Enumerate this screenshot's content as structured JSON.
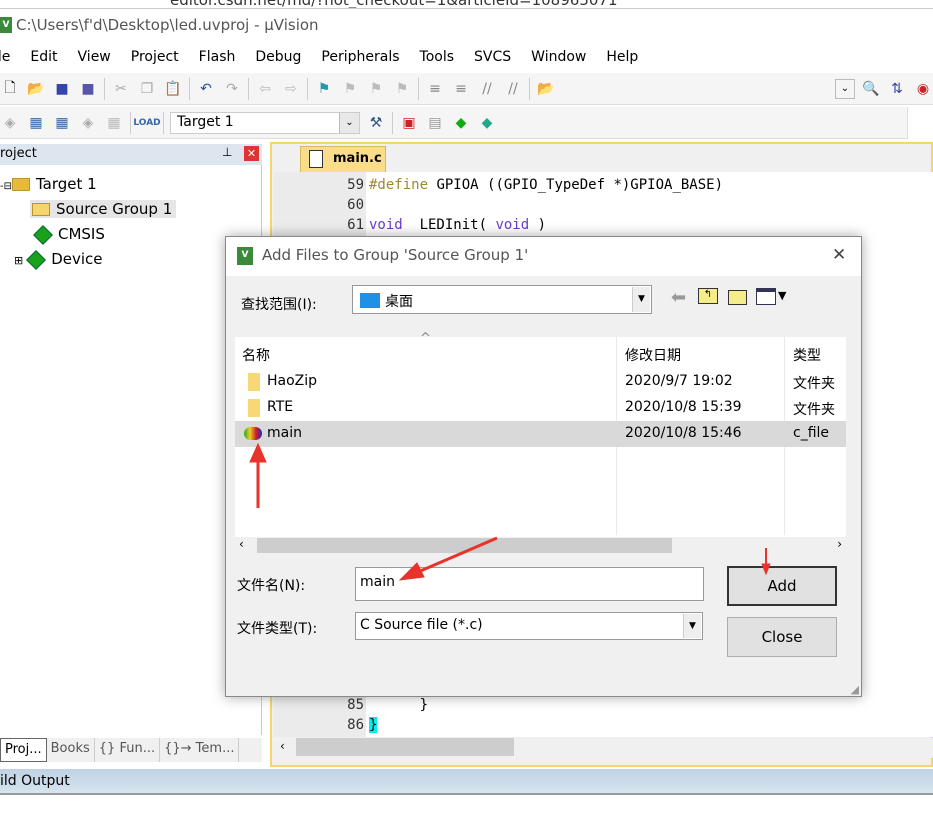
{
  "browser": {
    "url": "editor.csdn.net/md/?not_checkout=1&articleId=108965071"
  },
  "window": {
    "title": "C:\\Users\\f'd\\Desktop\\led.uvproj - μVision"
  },
  "menu": [
    "ile",
    "Edit",
    "View",
    "Project",
    "Flash",
    "Debug",
    "Peripherals",
    "Tools",
    "SVCS",
    "Window",
    "Help"
  ],
  "toolbar2": {
    "target": "Target 1"
  },
  "project": {
    "header": "roject",
    "tree": [
      "Target 1",
      "Source Group 1",
      "CMSIS",
      "Device"
    ],
    "tabs": [
      "Proj...",
      "Books",
      "{} Fun...",
      "{}→ Tem..."
    ]
  },
  "editor": {
    "tab": "main.c",
    "lines": [
      {
        "n": "59",
        "pp": "#define",
        "rest": " GPIOA ((GPIO_TypeDef *)GPIOA_BASE)"
      },
      {
        "n": "60",
        "text": ""
      },
      {
        "n": "61",
        "kw": "void",
        "mid": "  LEDInit( ",
        "kw2": "void",
        "end": " )"
      },
      {
        "n": "85",
        "text": "      }"
      },
      {
        "n": "86",
        "text": "}"
      }
    ]
  },
  "build_output": "ild Output",
  "dialog": {
    "title": "Add Files to Group 'Source Group 1'",
    "look_in_label": "查找范围(I):",
    "look_in": "桌面",
    "columns": [
      "名称",
      "修改日期",
      "类型"
    ],
    "files": [
      {
        "name": "HaoZip",
        "date": "2020/9/7 19:02",
        "type": "文件夹",
        "icon": "folder"
      },
      {
        "name": "RTE",
        "date": "2020/10/8 15:39",
        "type": "文件夹",
        "icon": "folder"
      },
      {
        "name": "main",
        "date": "2020/10/8 15:46",
        "type": "c_file",
        "icon": "c-file",
        "selected": true
      }
    ],
    "filename_label": "文件名(N):",
    "filename": "main",
    "filetype_label": "文件类型(T):",
    "filetype": "C Source file (*.c)",
    "add": "Add",
    "close": "Close"
  },
  "annotation_color": "#e8322b"
}
